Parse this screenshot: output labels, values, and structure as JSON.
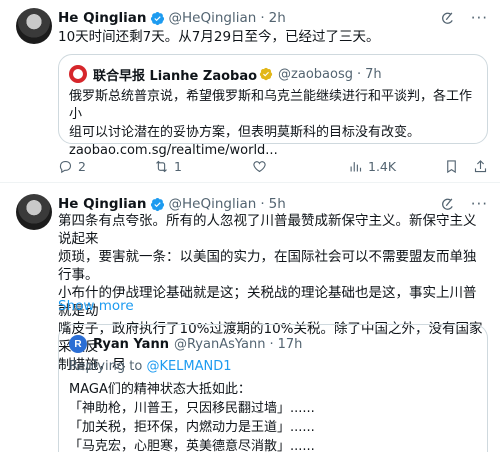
{
  "tweets": [
    {
      "author": "He Qinglian",
      "handle": "@HeQinglian",
      "time": "2h",
      "text": "10天时间还剩7天。从7月29日至今，已经过了三天。",
      "quote": {
        "author": "联合早报 Lianhe Zaobao",
        "handle": "@zaobaosg",
        "time": "7h",
        "text": "俄罗斯总统普京说，希望俄罗斯和乌克兰能继续进行和平谈判，各工作小\n组可以讨论潜在的妥协方案，但表明莫斯科的目标没有改变。\nzaobao.com.sg/realtime/world..."
      },
      "stats": {
        "replies": "2",
        "reposts": "1",
        "likes": "",
        "views": "1.4K"
      }
    },
    {
      "author": "He Qinglian",
      "handle": "@HeQinglian",
      "time": "5h",
      "text": "第四条有点夸张。所有的人忽视了川普最赞成新保守主义。新保守主义说起来\n烦琐，要害就一条：以美国的实力，在国际社会可以不需要盟友而单独行事。\n小布什的伊战理论基础就是这；关税战的理论基础也是这，事实上川普就是动\n嘴皮子，政府执行了10%过渡期的10%关税。除了中国之外，没有国家采取反\n制措施，尽",
      "show_more": "Show more",
      "quote": {
        "avatar_letter": "R",
        "author": "Ryan Yann",
        "handle": "@RyanAsYann",
        "time": "17h",
        "replying_prefix": "Replying to ",
        "replying_to": "@KELMAND1",
        "text": "MAGA们的精神状态大抵如此：\n「神助枪，川普王，只因移民翻过墙」......\n「加关税，拒环保，内燃动力是王道」......\n「马克宏，心胆寒，英美德意尽消散」......"
      }
    }
  ],
  "dot": "·",
  "colors": {
    "accent": "#1d9bf0",
    "muted": "#536471",
    "border": "#cfd9de",
    "verified": "#1d9bf0",
    "gold": "#e2b719"
  },
  "icons": [
    "verified-badge-icon",
    "grok-icon",
    "more-icon",
    "reply-icon",
    "repost-icon",
    "like-icon",
    "views-icon",
    "bookmark-icon",
    "share-icon"
  ]
}
